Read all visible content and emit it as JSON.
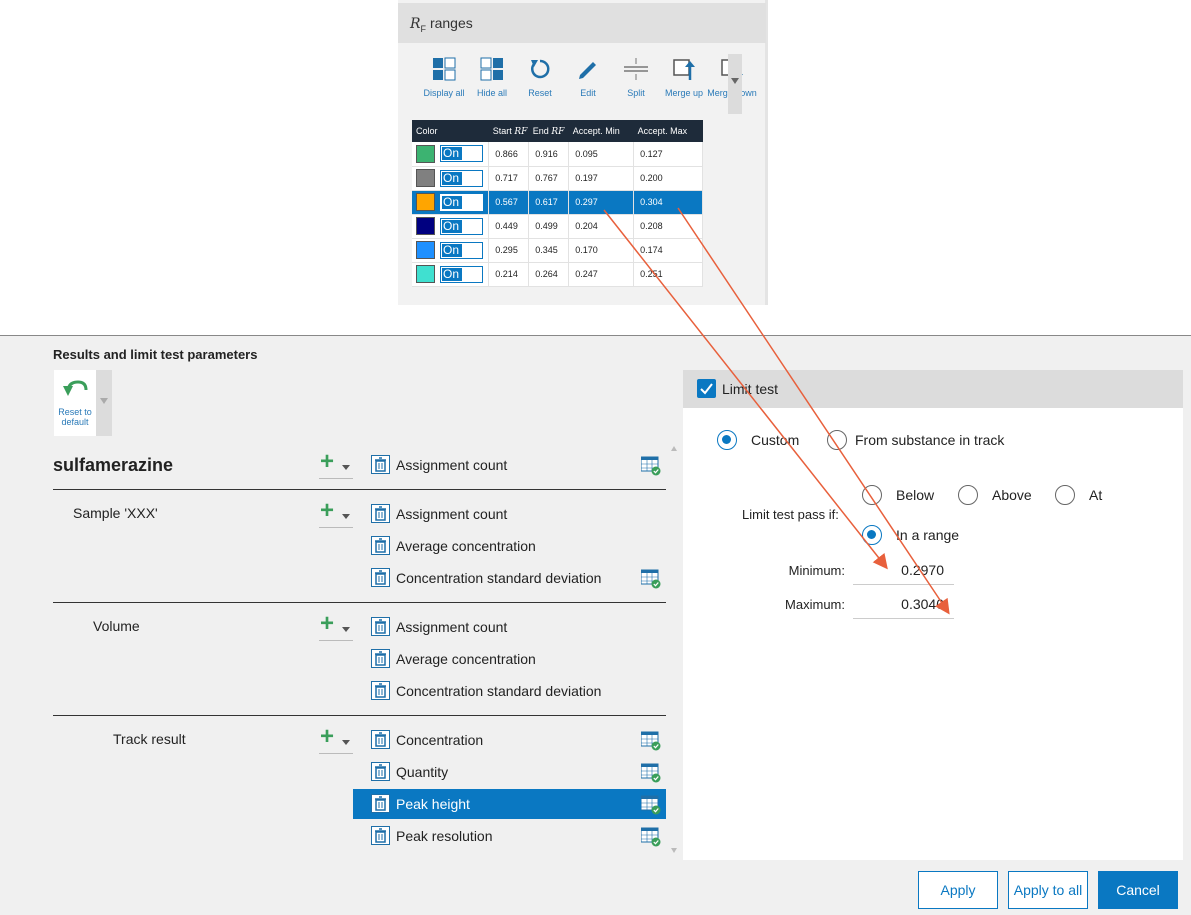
{
  "rf_panel": {
    "title_symbol": "R",
    "title_sub": "F",
    "title_text": "ranges",
    "toolbar": [
      {
        "label": "Display all",
        "icon": "display-all-icon"
      },
      {
        "label": "Hide all",
        "icon": "hide-all-icon"
      },
      {
        "label": "Reset",
        "icon": "reset-icon"
      },
      {
        "label": "Edit",
        "icon": "edit-pencil-icon"
      },
      {
        "label": "Split",
        "icon": "split-icon"
      },
      {
        "label": "Merge up",
        "icon": "merge-up-icon"
      },
      {
        "label": "Merge down",
        "icon": "merge-down-icon"
      }
    ],
    "table": {
      "headers": {
        "color": "Color",
        "start_prefix": "Start",
        "end_prefix": "End",
        "rf": "RF",
        "accept_min": "Accept. Min",
        "accept_max": "Accept. Max"
      },
      "toggle_label": "On",
      "rows": [
        {
          "color": "#3cb371",
          "start": "0.866",
          "end": "0.916",
          "min": "0.095",
          "max": "0.127",
          "selected": false
        },
        {
          "color": "#808080",
          "start": "0.717",
          "end": "0.767",
          "min": "0.197",
          "max": "0.200",
          "selected": false
        },
        {
          "color": "#ffa500",
          "start": "0.567",
          "end": "0.617",
          "min": "0.297",
          "max": "0.304",
          "selected": true
        },
        {
          "color": "#000080",
          "start": "0.449",
          "end": "0.499",
          "min": "0.204",
          "max": "0.208",
          "selected": false
        },
        {
          "color": "#1e90ff",
          "start": "0.295",
          "end": "0.345",
          "min": "0.170",
          "max": "0.174",
          "selected": false
        },
        {
          "color": "#40e0d0",
          "start": "0.214",
          "end": "0.264",
          "min": "0.247",
          "max": "0.251",
          "selected": false
        }
      ]
    }
  },
  "main": {
    "title": "Results and limit test parameters",
    "reset_label": "Reset to default",
    "groups": [
      {
        "label": "sulfamerazine",
        "items": [
          {
            "label": "Assignment count",
            "table_icon": true,
            "selected": false
          }
        ]
      },
      {
        "label": "Sample 'XXX'",
        "items": [
          {
            "label": "Assignment count",
            "table_icon": false,
            "selected": false
          },
          {
            "label": "Average concentration",
            "table_icon": false,
            "selected": false
          },
          {
            "label": "Concentration standard deviation",
            "table_icon": true,
            "selected": false
          }
        ]
      },
      {
        "label": "Volume",
        "items": [
          {
            "label": "Assignment count",
            "table_icon": false,
            "selected": false
          },
          {
            "label": "Average concentration",
            "table_icon": false,
            "selected": false
          },
          {
            "label": "Concentration standard deviation",
            "table_icon": false,
            "selected": false
          }
        ]
      },
      {
        "label": "Track result",
        "items": [
          {
            "label": "Concentration",
            "table_icon": true,
            "selected": false
          },
          {
            "label": "Quantity",
            "table_icon": true,
            "selected": false
          },
          {
            "label": "Peak height",
            "table_icon": true,
            "selected": true
          },
          {
            "label": "Peak resolution",
            "table_icon": true,
            "selected": false
          }
        ]
      }
    ]
  },
  "limit_test": {
    "title": "Limit test",
    "checked": true,
    "source_custom": "Custom",
    "source_track": "From substance in track",
    "pass_if_label": "Limit test pass if:",
    "opt_below": "Below",
    "opt_above": "Above",
    "opt_at": "At",
    "opt_range": "In a range",
    "min_label": "Minimum:",
    "min_value": "0.2970",
    "max_label": "Maximum:",
    "max_value": "0.3040"
  },
  "buttons": {
    "apply": "Apply",
    "apply_all": "Apply to all",
    "cancel": "Cancel"
  },
  "colors": {
    "accent": "#0a78c2",
    "arrow": "#e8603c",
    "header": "#1e2b3a"
  }
}
